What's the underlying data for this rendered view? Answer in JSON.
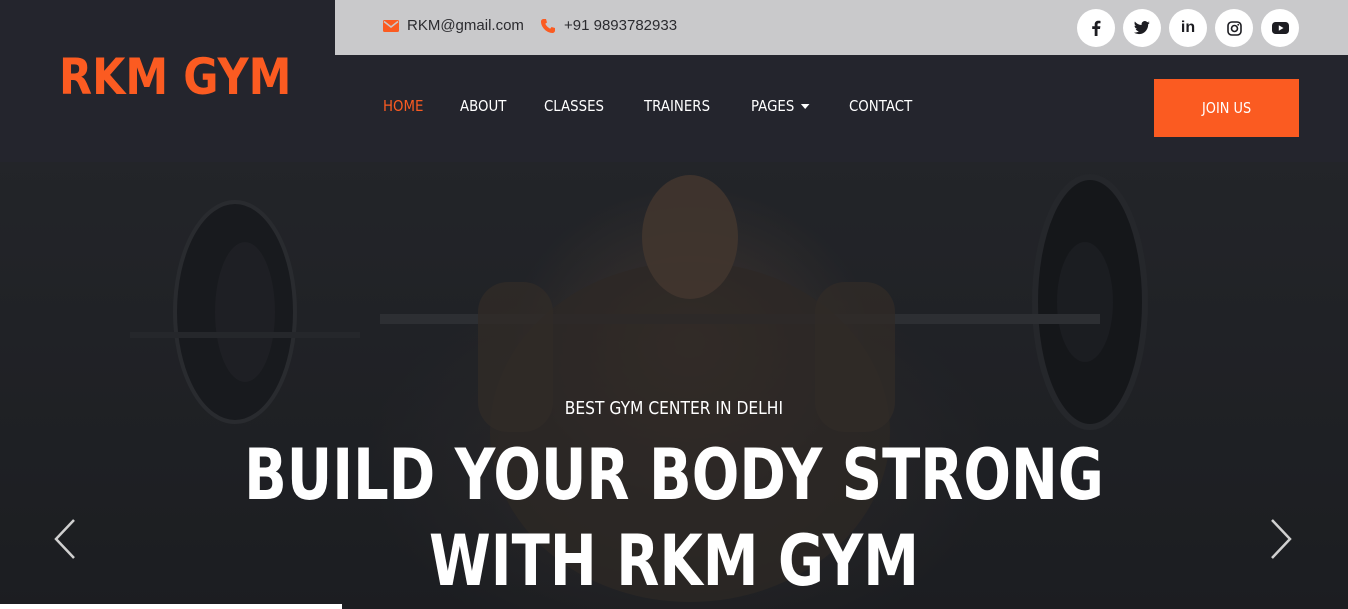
{
  "brand": {
    "logo": "RKM GYM",
    "accent": "#fb5b21"
  },
  "topbar": {
    "email": "RKM@gmail.com",
    "phone": "+91 9893782933",
    "socials": [
      {
        "icon": "facebook-icon",
        "glyph": "f"
      },
      {
        "icon": "twitter-icon",
        "glyph": ""
      },
      {
        "icon": "linkedin-icon",
        "glyph": "in"
      },
      {
        "icon": "instagram-icon",
        "glyph": ""
      },
      {
        "icon": "youtube-icon",
        "glyph": ""
      }
    ]
  },
  "nav": {
    "items": [
      {
        "label": "HOME",
        "active": true
      },
      {
        "label": "ABOUT"
      },
      {
        "label": "CLASSES"
      },
      {
        "label": "TRAINERS"
      },
      {
        "label": "PAGES",
        "dropdown": true
      },
      {
        "label": "CONTACT"
      }
    ],
    "cta": "JOIN US"
  },
  "hero": {
    "subtitle": "BEST GYM CENTER IN DELHI",
    "title_line1": "BUILD YOUR BODY STRONG",
    "title_line2": "WITH RKM GYM"
  }
}
